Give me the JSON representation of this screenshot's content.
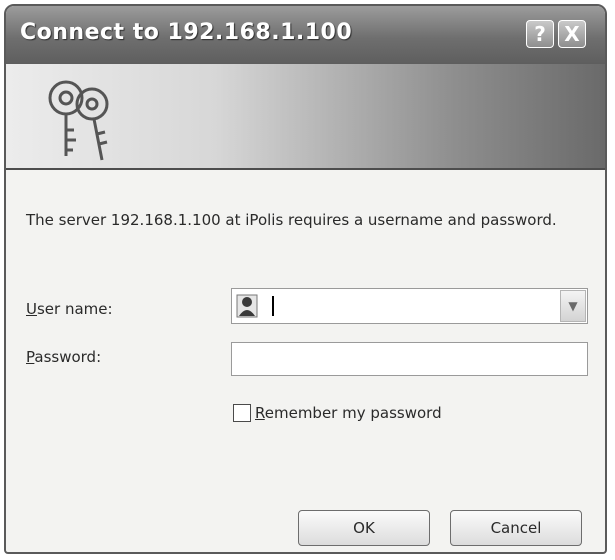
{
  "window": {
    "title": "Connect to 192.168.1.100",
    "help_glyph": "?",
    "close_glyph": "X"
  },
  "banner": {
    "icon": "keys-icon"
  },
  "message": "The server 192.168.1.100 at iPolis requires a username and password.",
  "form": {
    "user_label_hotkey": "U",
    "user_label_rest": "ser name:",
    "user_value": "",
    "password_label_hotkey": "P",
    "password_label_rest": "assword:",
    "password_value": "",
    "remember_hotkey": "R",
    "remember_rest": "emember my password",
    "remember_checked": false
  },
  "buttons": {
    "ok_label": "OK",
    "cancel_label": "Cancel"
  },
  "colors": {
    "titlebar": "#6f6f6f",
    "dialog_background": "#f3f3f1",
    "title_text": "#ffffff"
  }
}
